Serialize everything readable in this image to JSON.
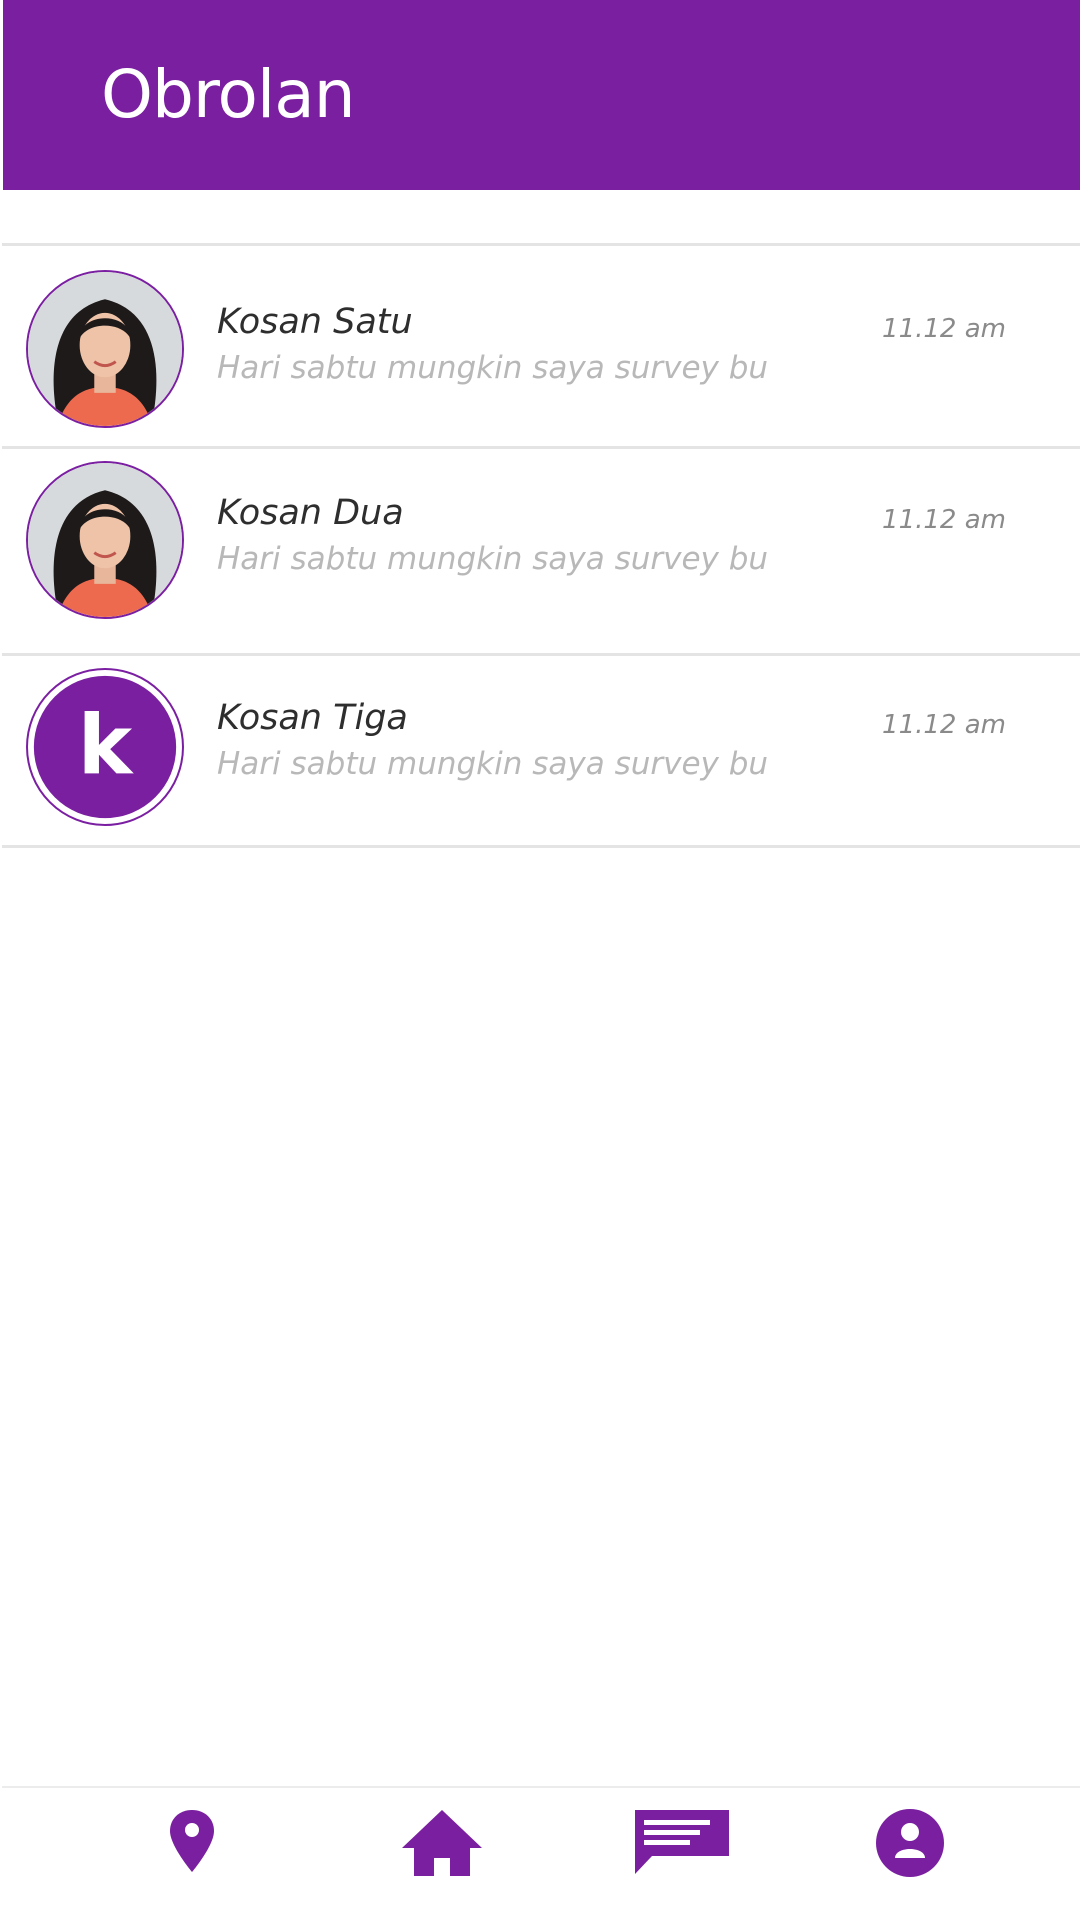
{
  "header": {
    "title": "Obrolan"
  },
  "chats": [
    {
      "name": "Kosan Satu",
      "preview": "Hari sabtu mungkin saya survey bu",
      "time": "11.12 am",
      "avatar": "photo"
    },
    {
      "name": "Kosan Dua",
      "preview": "Hari sabtu mungkin saya survey bu",
      "time": "11.12 am",
      "avatar": "photo"
    },
    {
      "name": "Kosan Tiga",
      "preview": "Hari sabtu mungkin saya survey bu",
      "time": "11.12 am",
      "avatar": "logo",
      "avatar_letter": "k"
    }
  ],
  "nav": {
    "items": [
      {
        "icon": "map-pin-icon"
      },
      {
        "icon": "home-icon"
      },
      {
        "icon": "chat-icon"
      },
      {
        "icon": "profile-icon"
      }
    ]
  },
  "colors": {
    "brand": "#791fa0",
    "name": "#2e2e2e",
    "preview": "#b8b8b8",
    "time": "#8a8a8a",
    "divider": "#e4e4e4"
  }
}
